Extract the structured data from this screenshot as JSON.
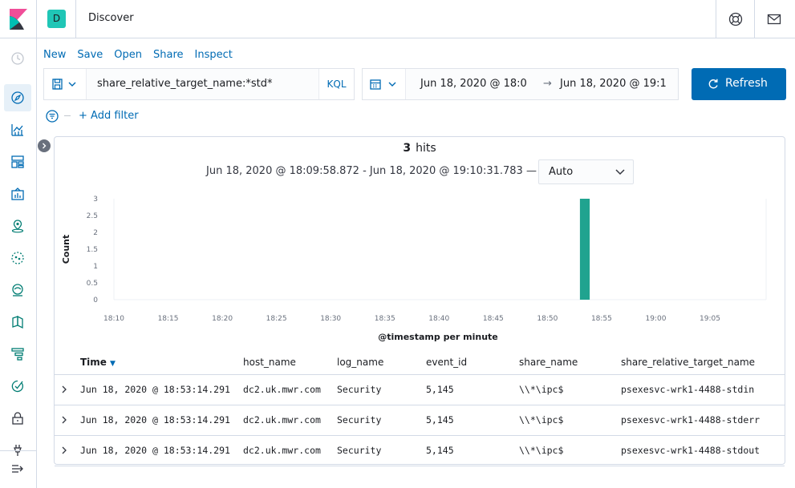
{
  "header": {
    "space_initial": "D",
    "app_title": "Discover",
    "icons": [
      "help-icon",
      "newsfeed-icon"
    ]
  },
  "nav": {
    "items": [
      "clock-icon",
      "discover-icon",
      "visualize-icon",
      "dashboard-icon",
      "canvas-icon",
      "maps-icon",
      "ml-icon",
      "metrics-icon",
      "logs-icon",
      "apm-icon",
      "uptime-icon",
      "siem-icon",
      "dev-tools-icon",
      "dock-navigation-icon"
    ]
  },
  "menu": {
    "new": "New",
    "save": "Save",
    "open": "Open",
    "share": "Share",
    "inspect": "Inspect"
  },
  "query": {
    "text": "share_relative_target_name:*std*",
    "language": "KQL"
  },
  "time": {
    "start": "Jun 18, 2020 @ 18:0",
    "arrow": "→",
    "end": "Jun 18, 2020 @ 19:1"
  },
  "refresh_label": "Refresh",
  "filter": {
    "add_label": "+ Add filter"
  },
  "results": {
    "hits_count": "3",
    "hits_label": "hits",
    "range": "Jun 18, 2020 @ 18:09:58.872 - Jun 18, 2020 @ 19:10:31.783 —",
    "interval": "Auto"
  },
  "colors": {
    "accent": "#006bb4",
    "bar": "#20a38f",
    "space_badge": "#20c6b6"
  },
  "chart_data": {
    "type": "bar",
    "ylabel": "Count",
    "xlabel": "@timestamp per minute",
    "y_ticks": [
      "0",
      "0.5",
      "1",
      "1.5",
      "2",
      "2.5",
      "3"
    ],
    "ylim": [
      0,
      3
    ],
    "x_ticks": [
      "18:10",
      "18:15",
      "18:20",
      "18:25",
      "18:30",
      "18:35",
      "18:40",
      "18:45",
      "18:50",
      "18:55",
      "19:00",
      "19:05"
    ],
    "xlim_minutes": [
      10,
      70
    ],
    "bars": [
      {
        "x": "18:53",
        "minute": 53,
        "value": 3
      }
    ]
  },
  "table": {
    "columns": [
      "Time",
      "host_name",
      "log_name",
      "event_id",
      "share_name",
      "share_relative_target_name"
    ],
    "rows": [
      [
        "Jun 18, 2020 @ 18:53:14.291",
        "dc2.uk.mwr.com",
        "Security",
        "5,145",
        "\\\\*\\ipc$",
        "psexesvc-wrk1-4488-stdin"
      ],
      [
        "Jun 18, 2020 @ 18:53:14.291",
        "dc2.uk.mwr.com",
        "Security",
        "5,145",
        "\\\\*\\ipc$",
        "psexesvc-wrk1-4488-stderr"
      ],
      [
        "Jun 18, 2020 @ 18:53:14.291",
        "dc2.uk.mwr.com",
        "Security",
        "5,145",
        "\\\\*\\ipc$",
        "psexesvc-wrk1-4488-stdout"
      ]
    ]
  }
}
